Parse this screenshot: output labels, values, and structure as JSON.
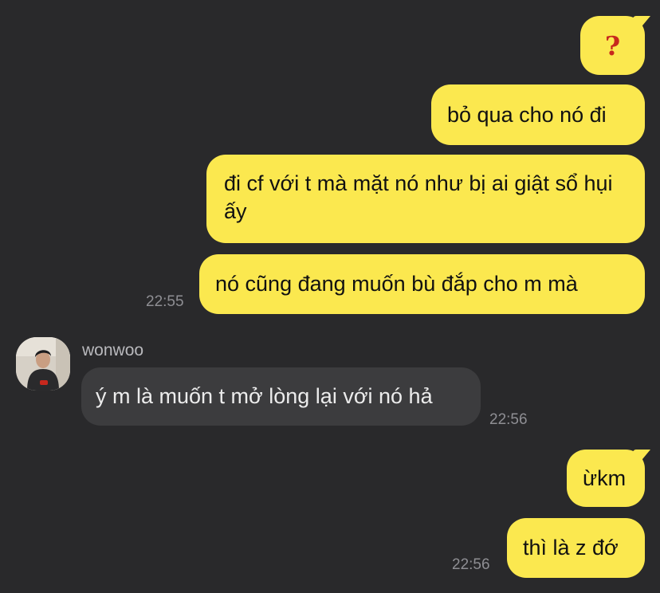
{
  "messages": [
    {
      "text": "?",
      "side": "out"
    },
    {
      "text": "bỏ qua cho nó đi",
      "side": "out"
    },
    {
      "text": "đi cf với t mà mặt nó như bị ai giật sổ hụi ấy",
      "side": "out"
    },
    {
      "text": "nó cũng đang muốn bù đắp cho m mà",
      "side": "out",
      "time": "22:55"
    },
    {
      "text": "ý m là muốn t mở lòng lại với nó hả",
      "side": "in",
      "sender": "wonwoo",
      "time": "22:56"
    },
    {
      "text": "ừkm",
      "side": "out"
    },
    {
      "text": "thì là z đớ",
      "side": "out",
      "time": "22:56"
    }
  ],
  "colors": {
    "background": "#29292b",
    "outgoing_bubble": "#fbe84f",
    "incoming_bubble": "#3c3c3e",
    "timestamp": "#8e8e93",
    "question_mark": "#c7281d"
  },
  "icons": {
    "avatar": "avatar-photo"
  }
}
